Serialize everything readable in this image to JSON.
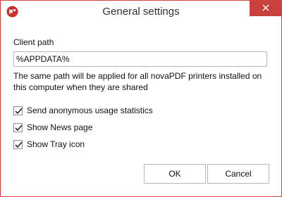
{
  "window": {
    "title": "General settings",
    "border_color": "#d0453f",
    "close_button_color": "#c7423d"
  },
  "client_path": {
    "label": "Client path",
    "value": "%APPDATA%"
  },
  "note": "The same path will be applied for all novaPDF printers installed on this computer when they are shared",
  "options": [
    {
      "label": "Send anonymous usage statistics",
      "checked": true
    },
    {
      "label": "Show News page",
      "checked": true
    },
    {
      "label": "Show Tray icon",
      "checked": true
    }
  ],
  "buttons": {
    "ok": "OK",
    "cancel": "Cancel"
  },
  "icons": {
    "app": "novapdf-logo-icon",
    "close": "close-icon",
    "check": "checkmark-icon"
  }
}
